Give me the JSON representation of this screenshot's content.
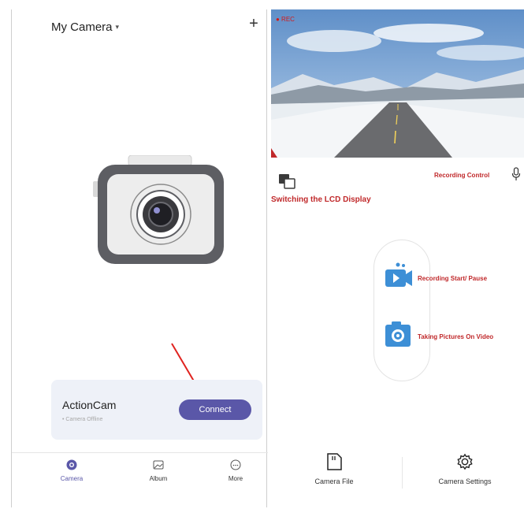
{
  "left_screen": {
    "title": "My Camera",
    "title_caret": "▾",
    "add_icon": "plus-icon",
    "add_label": "+",
    "device": {
      "name": "ActionCam",
      "status": "• Camera Offline",
      "connect_label": "Connect"
    },
    "tabs": [
      {
        "label": "Camera",
        "icon": "camera-tab-icon",
        "active": true
      },
      {
        "label": "Album",
        "icon": "album-icon",
        "active": false
      },
      {
        "label": "More",
        "icon": "more-icon",
        "active": false
      }
    ],
    "accent_color": "#5a57a8"
  },
  "right_screen": {
    "preview_overlay_text": "● REC",
    "annotations": {
      "lcd_switch": "Switching the LCD Display",
      "recording_control": "Recording Control",
      "record_start_pause": "Recording Start/ Pause",
      "taking_pictures": "Taking Pictures On Video"
    },
    "bottom": {
      "camera_file_label": "Camera File",
      "camera_settings_label": "Camera Settings"
    },
    "annotation_color": "#c0282a"
  }
}
